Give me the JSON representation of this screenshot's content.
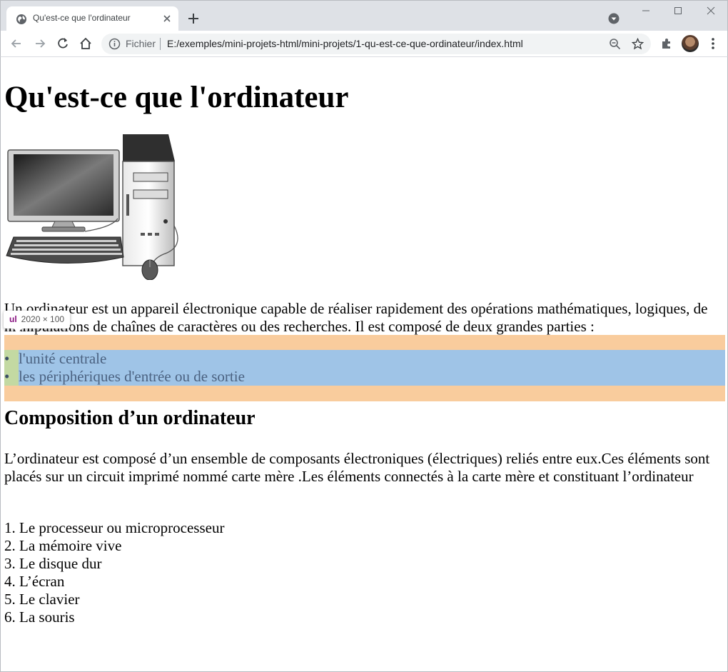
{
  "browser": {
    "tab_title": "Qu'est-ce que l'ordinateur",
    "scheme_label": "Fichier",
    "url": "E:/exemples/mini-projets-html/mini-projets/1-qu-est-ce-que-ordinateur/index.html"
  },
  "devtools_tooltip": {
    "tag": "ul",
    "size": "2020 × 100"
  },
  "page": {
    "title": "Qu'est-ce que l'ordinateur",
    "intro": "Un ordinateur est un appareil électronique capable de réaliser rapidement des opérations mathématiques, logiques, de manipulations de chaînes de caractères ou des recherches. Il est composé de deux grandes parties :",
    "parts": [
      "l'unité centrale",
      "les périphériques d'entrée ou de sortie"
    ],
    "section_title": "Composition d’un ordinateur",
    "section_text": "L’ordinateur est composé d’un ensemble de composants électroniques (électriques) reliés entre eux.Ces éléments sont placés sur un circuit imprimé nommé carte mère .Les éléments connectés à la carte mère et constituant l’ordinateur",
    "components": [
      "1. Le processeur ou microprocesseur",
      "2. La mémoire vive",
      "3. Le disque dur",
      "4. L’écran",
      "5. Le clavier",
      "6. La souris"
    ]
  },
  "icons": {
    "favicon": "globe-icon",
    "tab_close": "close-icon",
    "new_tab": "plus-icon",
    "back": "arrow-left-icon",
    "forward": "arrow-right-icon",
    "reload": "reload-icon",
    "home": "home-icon",
    "info": "info-icon",
    "zoom": "zoom-icon",
    "bookmark": "star-icon",
    "extensions": "puzzle-icon",
    "menu": "kebab-icon"
  }
}
